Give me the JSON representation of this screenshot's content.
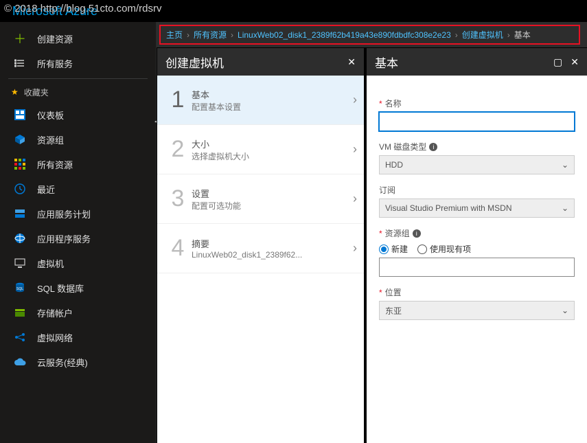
{
  "watermark": "© 2018 http://blog.51cto.com/rdsrv",
  "brand": "Microsoft Azure",
  "sidebar": {
    "create": "创建资源",
    "all_services": "所有服务",
    "favorites_label": "收藏夹",
    "items": [
      "仪表板",
      "资源组",
      "所有资源",
      "最近",
      "应用服务计划",
      "应用程序服务",
      "虚拟机",
      "SQL 数据库",
      "存储帐户",
      "虚拟网络",
      "云服务(经典)"
    ]
  },
  "breadcrumb": {
    "items": [
      "主页",
      "所有资源",
      "LinuxWeb02_disk1_2389f62b419a43e890fdbdfc308e2e23",
      "创建虚拟机"
    ],
    "current": "基本"
  },
  "bladeA": {
    "title": "创建虚拟机",
    "steps": [
      {
        "num": "1",
        "t1": "基本",
        "t2": "配置基本设置",
        "active": true
      },
      {
        "num": "2",
        "t1": "大小",
        "t2": "选择虚拟机大小",
        "active": false
      },
      {
        "num": "3",
        "t1": "设置",
        "t2": "配置可选功能",
        "active": false
      },
      {
        "num": "4",
        "t1": "摘要",
        "t2": "LinuxWeb02_disk1_2389f62...",
        "active": false
      }
    ]
  },
  "bladeB": {
    "title": "基本",
    "name_label": "名称",
    "name_value": "",
    "disk_label": "VM 磁盘类型",
    "disk_value": "HDD",
    "sub_label": "订阅",
    "sub_value": "Visual Studio Premium with MSDN",
    "rg_label": "资源组",
    "rg_new": "新建",
    "rg_existing": "使用现有项",
    "rg_value": "",
    "loc_label": "位置",
    "loc_value": "东亚"
  }
}
